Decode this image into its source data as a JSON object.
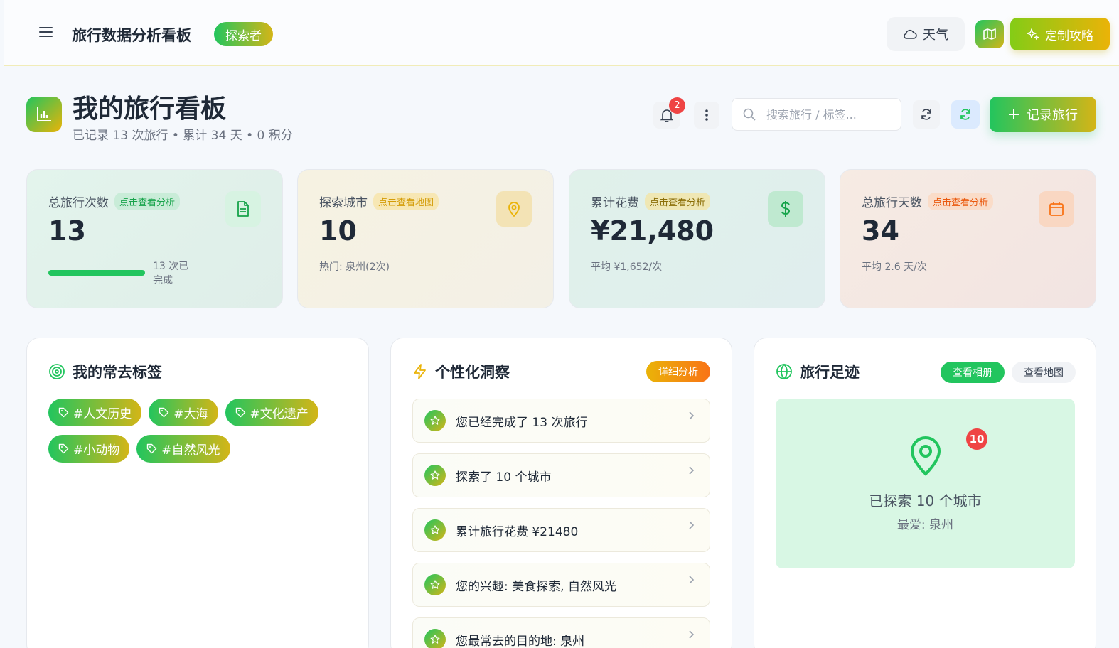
{
  "topbar": {
    "app_title": "旅行数据分析看板",
    "role_badge": "探索者",
    "weather_label": "天气",
    "guide_label": "定制攻略"
  },
  "header": {
    "title": "我的旅行看板",
    "subtitle": "已记录 13 次旅行 • 累计 34 天 • 0 积分",
    "notification_count": "2",
    "search_placeholder": "搜索旅行 / 标签...",
    "record_label": "记录旅行"
  },
  "stats": [
    {
      "label": "总旅行次数",
      "tag": "点击查看分析",
      "value": "13",
      "progress_text": "13 次已完成",
      "progress_fraction": 1.0,
      "icon": "document-icon"
    },
    {
      "label": "探索城市",
      "tag": "点击查看地图",
      "value": "10",
      "note": "热门: 泉州(2次)",
      "icon": "map-pin-icon"
    },
    {
      "label": "累计花费",
      "tag": "点击查看分析",
      "value": "¥21,480",
      "note": "平均 ¥1,652/次",
      "icon": "dollar-icon"
    },
    {
      "label": "总旅行天数",
      "tag": "点击查看分析",
      "value": "34",
      "note": "平均 2.6 天/次",
      "icon": "calendar-icon"
    }
  ],
  "tags_panel": {
    "title": "我的常去标签",
    "tags": [
      "#人文历史",
      "#大海",
      "#文化遗产",
      "#小动物",
      "#自然风光"
    ]
  },
  "insights_panel": {
    "title": "个性化洞察",
    "detail_label": "详细分析",
    "items": [
      "您已经完成了 13 次旅行",
      "探索了 10 个城市",
      "累计旅行花费 ¥21480",
      "您的兴趣: 美食探索, 自然风光",
      "您最常去的目的地: 泉州"
    ]
  },
  "footprint_panel": {
    "title": "旅行足迹",
    "album_label": "查看相册",
    "map_label": "查看地图",
    "city_count": "10",
    "explored_text": "已探索 10 个城市",
    "favorite_text": "最爱: 泉州"
  },
  "colors": {
    "accent_green": "#22c55e",
    "accent_yellow": "#eab308",
    "badge_red": "#ef4444"
  }
}
